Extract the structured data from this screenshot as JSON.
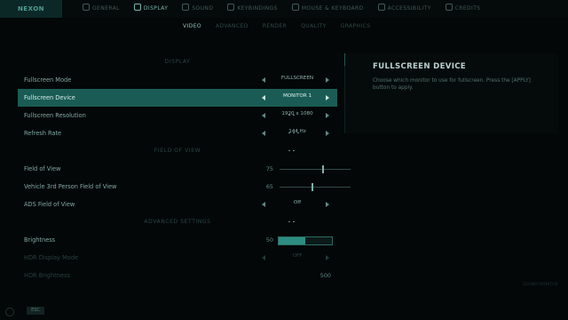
{
  "brand": "NEXON",
  "nav": {
    "tabs": [
      {
        "label": "GENERAL",
        "icon": "gear-icon",
        "active": false
      },
      {
        "label": "DISPLAY",
        "icon": "monitor-icon",
        "active": true
      },
      {
        "label": "SOUND",
        "icon": "speaker-icon",
        "active": false
      },
      {
        "label": "KEYBINDINGS",
        "icon": "keyboard-icon",
        "active": false
      },
      {
        "label": "MOUSE & KEYBOARD",
        "icon": "mouse-icon",
        "active": false
      },
      {
        "label": "ACCESSIBILITY",
        "icon": "accessibility-icon",
        "active": false
      },
      {
        "label": "CREDITS",
        "icon": "info-icon",
        "active": false
      }
    ],
    "subtabs": [
      {
        "label": "VIDEO",
        "active": true
      },
      {
        "label": "ADVANCED",
        "active": false
      },
      {
        "label": "RENDER",
        "active": false
      },
      {
        "label": "QUALITY",
        "active": false
      },
      {
        "label": "GRAPHICS",
        "active": false
      }
    ]
  },
  "settings": {
    "display_section": "DISPLAY",
    "fullscreen_mode": {
      "label": "Fullscreen Mode",
      "value": "FULLSCREEN"
    },
    "fullscreen_device": {
      "label": "Fullscreen Device",
      "value": "MONITOR 1"
    },
    "fullscreen_resolution": {
      "label": "Fullscreen Resolution",
      "value": "1920 x 1080"
    },
    "refresh_rate": {
      "label": "Refresh Rate",
      "value": "144 Hz"
    },
    "fov_section": "FIELD OF VIEW",
    "field_of_view": {
      "label": "Field of View",
      "value": "75",
      "level": 0.6
    },
    "vehicle_fov": {
      "label": "Vehicle 3rd Person Field of View",
      "value": "65",
      "level": 0.45
    },
    "ads_fov": {
      "label": "ADS Field of View",
      "value": "Off"
    },
    "advanced_section": "ADVANCED SETTINGS",
    "brightness": {
      "label": "Brightness",
      "value": "50",
      "level": 0.5
    },
    "hdr": {
      "label": "HDR Display Mode",
      "value": "OFF"
    },
    "hdr_brightness": {
      "label": "HDR Brightness",
      "value": "500"
    }
  },
  "description": {
    "title": "FULLSCREEN DEVICE",
    "text": "Choose which monitor to use for fullscreen. Press the [APPLY] button to apply."
  },
  "footer": {
    "esc_label": "ESC",
    "corner_text": "SOUND MONITOR"
  }
}
